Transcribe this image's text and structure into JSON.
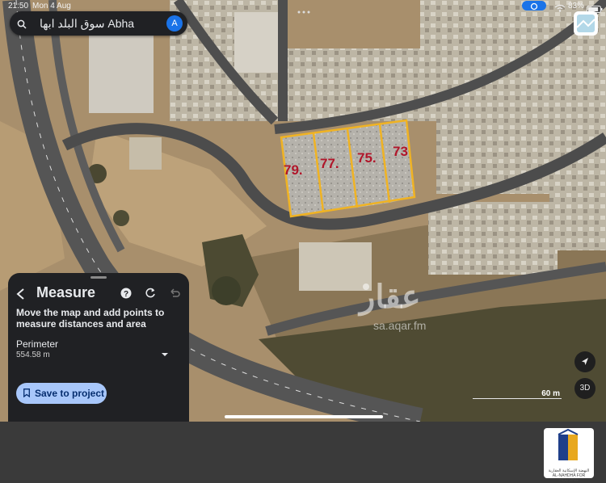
{
  "status_bar": {
    "time": "21:50",
    "date": "Mon 4 Aug",
    "battery": "83%"
  },
  "search": {
    "query": "سوق البلد ابها Abha",
    "avatar_letter": "A"
  },
  "lots": [
    {
      "label": "79."
    },
    {
      "label": "77."
    },
    {
      "label": "75."
    },
    {
      "label": "73"
    }
  ],
  "measure": {
    "title": "Measure",
    "hint": "Move the map and add points to measure distances and area",
    "perimeter_label": "Perimeter",
    "perimeter_value": "554.58 m",
    "save_label": "Save to project"
  },
  "map_controls": {
    "view_3d_label": "3D",
    "scale_label": "60 m"
  },
  "watermark": {
    "brand": "عقار",
    "site": "sa.aqar.fm"
  },
  "logo": {
    "caption": "النهضة الإسكانية العقارية AL-NAHDHA FOR HOUSING"
  },
  "colors": {
    "lot_outline": "#f0b323",
    "lot_label": "#b0162a",
    "panel_bg": "#202124",
    "save_button": "#a8c7fa"
  }
}
